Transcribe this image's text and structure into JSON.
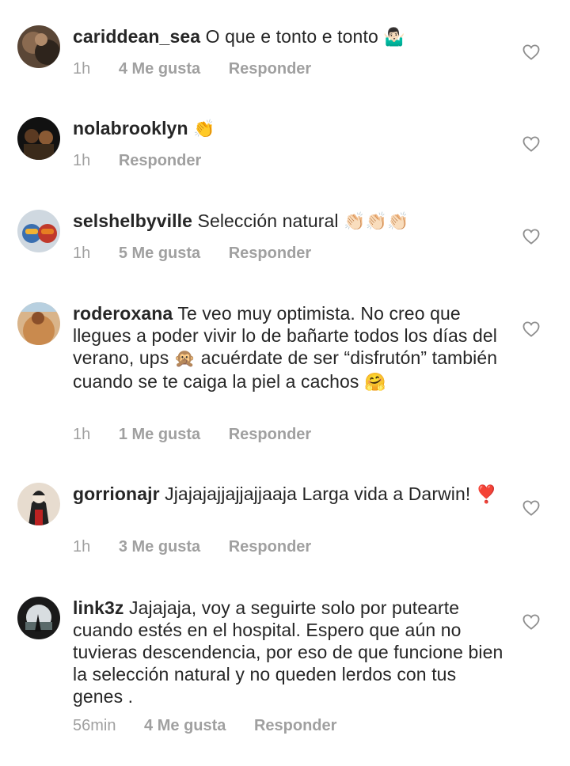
{
  "comments": [
    {
      "username": "cariddean_sea",
      "text": "O que e tonto e tonto",
      "emoji": "🤷🏻‍♂️",
      "time": "1h",
      "likes": "4 Me gusta",
      "reply": "Responder"
    },
    {
      "username": "nolabrooklyn",
      "text": "",
      "emoji": "👏",
      "time": "1h",
      "likes": "",
      "reply": "Responder"
    },
    {
      "username": "selshelbyville",
      "text": "Selección natural",
      "emoji": "👏🏻👏🏻👏🏻",
      "time": "1h",
      "likes": "5 Me gusta",
      "reply": "Responder"
    },
    {
      "username": "roderoxana",
      "text_a": "Te veo muy optimista. No creo que llegues a poder vivir lo de bañarte todos los días del verano, ups",
      "emoji_a": "🙊",
      "text_b": "acuérdate de ser “disfrutón” también cuando se te caiga la piel a cachos",
      "emoji_b": "🤗",
      "time": "1h",
      "likes": "1 Me gusta",
      "reply": "Responder"
    },
    {
      "username": "gorrionajr",
      "text": "Jjajajajjajjajjaaja Larga vida a Darwin!",
      "emoji": "❣️",
      "time": "1h",
      "likes": "3 Me gusta",
      "reply": "Responder"
    },
    {
      "username": "link3z",
      "text": "Jajajaja, voy a seguirte solo por putearte cuando estés en el hospital. Espero que aún no tuvieras descendencia, por eso de que funcione bien la selección natural y no queden lerdos con tus genes .",
      "time": "56min",
      "likes": "4 Me gusta",
      "reply": "Responder"
    }
  ],
  "icons": {
    "like": "heart-outline-icon",
    "avatar": "user-avatar"
  },
  "colors": {
    "text": "#262626",
    "meta": "#a0a0a0",
    "heart_stroke": "#8e8e8e"
  }
}
